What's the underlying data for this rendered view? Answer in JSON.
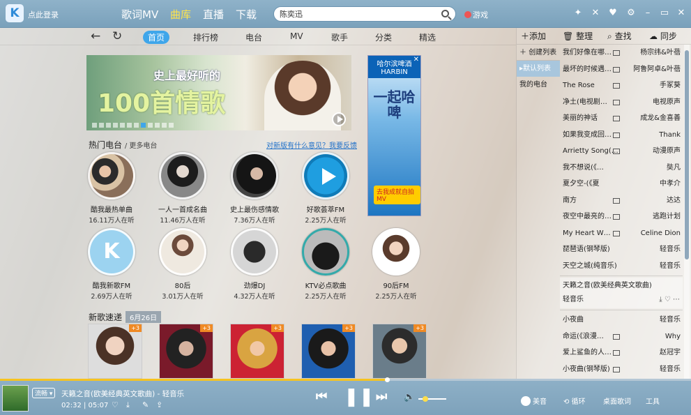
{
  "header": {
    "login": "点此登录",
    "tabs": [
      "歌词MV",
      "曲库",
      "直播",
      "下载"
    ],
    "active_tab": "曲库",
    "search_value": "陈奕迅",
    "game": "游戏"
  },
  "nav": {
    "tabs": [
      "首页",
      "排行榜",
      "电台",
      "MV",
      "歌手",
      "分类",
      "精选"
    ],
    "active": "首页"
  },
  "banner": {
    "line1": "史上最好听的",
    "line2": "100首情歌"
  },
  "ad": {
    "brand": "哈尔滨啤酒",
    "brand_en": "HARBIN",
    "slogan": "一起哈啤",
    "button": "去我成就自拍MV"
  },
  "hot": {
    "title": "热门电台",
    "more": "更多电台",
    "feedback": "对新版有什么意见？我要反馈",
    "stations": [
      {
        "name": "酷我最热单曲",
        "count": "16.11万人在听"
      },
      {
        "name": "一人一首成名曲",
        "count": "11.46万人在听"
      },
      {
        "name": "史上最伤感情歌",
        "count": "7.36万人在听"
      },
      {
        "name": "好歌荟萃FM",
        "count": "2.25万人在听"
      },
      {
        "name": "酷我新歌FM",
        "count": "2.69万人在听"
      },
      {
        "name": "80后",
        "count": "3.01万人在听"
      },
      {
        "name": "劲爆DJ",
        "count": "4.32万人在听"
      },
      {
        "name": "KTV必点歌曲",
        "count": "2.25万人在听"
      },
      {
        "name": "90后FM",
        "count": "2.25万人在听"
      }
    ]
  },
  "new_songs": {
    "title": "新歌速递",
    "date": "6月26日",
    "tag": "+3"
  },
  "right": {
    "tools": [
      "添加",
      "整理",
      "查找",
      "同步"
    ],
    "lists": [
      "创建列表",
      "默认列表",
      "我的电台"
    ],
    "songs": [
      {
        "t": "我们好像在哪…",
        "a": "杨宗纬&叶蓓",
        "mv": true
      },
      {
        "t": "最坏的时候遇…",
        "a": "阿鲁阿卓&叶蓓",
        "mv": true
      },
      {
        "t": "The Rose",
        "a": "手冢葵",
        "mv": true
      },
      {
        "t": "净土(电视剧…",
        "a": "电视原声",
        "mv": true
      },
      {
        "t": "美丽的神话",
        "a": "成龙&金喜善",
        "mv": true
      },
      {
        "t": "如果我变成回…",
        "a": "Thank",
        "mv": true
      },
      {
        "t": "Arrietty Song(…",
        "a": "动漫原声",
        "mv": true
      },
      {
        "t": "我不想说(《…",
        "a": "奘凡",
        "mv": false
      },
      {
        "t": "夏夕空-(《夏",
        "a": "中孝介",
        "mv": false
      },
      {
        "t": "南方",
        "a": "达达",
        "mv": true
      },
      {
        "t": "夜空中最亮的…",
        "a": "逃跑计划",
        "mv": true
      },
      {
        "t": "My Heart W…",
        "a": "Celine Dion",
        "mv": true
      },
      {
        "t": "琵琶语(钢琴版)",
        "a": "轻音乐",
        "mv": false
      },
      {
        "t": "天空之城(纯音乐)",
        "a": "轻音乐",
        "mv": false
      }
    ],
    "playing": {
      "t": "天籁之音(欧美经典英文歌曲)",
      "a": "轻音乐"
    },
    "after": [
      {
        "t": "小夜曲",
        "a": "轻音乐",
        "mv": false
      },
      {
        "t": "命运(《浪漫…",
        "a": "Why",
        "mv": true
      },
      {
        "t": "爱上鲨鱼的人…",
        "a": "赵冠宇",
        "mv": true
      },
      {
        "t": "小夜曲(钢琴版)",
        "a": "轻音乐",
        "mv": true
      }
    ]
  },
  "player": {
    "fluency": "流畅",
    "now": "天籁之音(欧美经典英文歌曲) - 轻音乐",
    "time": "02:32 | 05:07",
    "buttons": [
      "美音",
      "循环",
      "桌面歌词",
      "工具"
    ],
    "progress": 0.56,
    "volume": 0.25
  }
}
